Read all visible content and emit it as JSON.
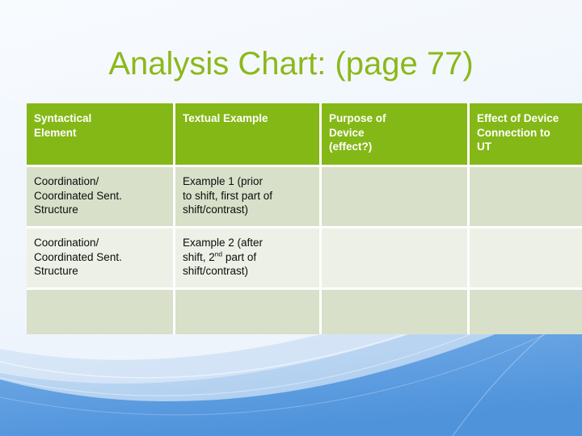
{
  "slide": {
    "title": "Analysis Chart: (page 77)",
    "title_color": "#8cb81a",
    "background_color": "#f4f8fd",
    "accent_blue": "#5b9bdf"
  },
  "table": {
    "header_bg": "#84b816",
    "header_text_color": "#ffffff",
    "row_bg_dark": "#d8e0c9",
    "row_bg_light": "#ecf0e6",
    "gridline_color": "#ffffff",
    "headers": [
      {
        "line1": "Syntactical",
        "line2": "Element",
        "line3": ""
      },
      {
        "line1": "Textual Example",
        "line2": "",
        "line3": ""
      },
      {
        "line1": "Purpose of",
        "line2": "Device",
        "line3": "(effect?)"
      },
      {
        "line1": "Effect of Device",
        "line2": "Connection to",
        "line3": "UT"
      }
    ],
    "rows": [
      {
        "syntactical_element": {
          "line1": "Coordination/",
          "line2": "Coordinated Sent.",
          "line3": "Structure"
        },
        "textual_example": {
          "line1": "Example 1 (prior",
          "line2": "to shift, first part of",
          "line3": "shift/contrast)"
        },
        "purpose_of_device": "",
        "effect_of_device": ""
      },
      {
        "syntactical_element": {
          "line1": "Coordination/",
          "line2": "Coordinated Sent.",
          "line3": "Structure"
        },
        "textual_example": {
          "line1": "Example 2 (after",
          "line2_pre": "shift, 2",
          "line2_sup": "nd",
          "line2_post": " part of",
          "line3": "shift/contrast)"
        },
        "purpose_of_device": "",
        "effect_of_device": ""
      },
      {
        "syntactical_element": "",
        "textual_example": "",
        "purpose_of_device": "",
        "effect_of_device": ""
      }
    ]
  }
}
